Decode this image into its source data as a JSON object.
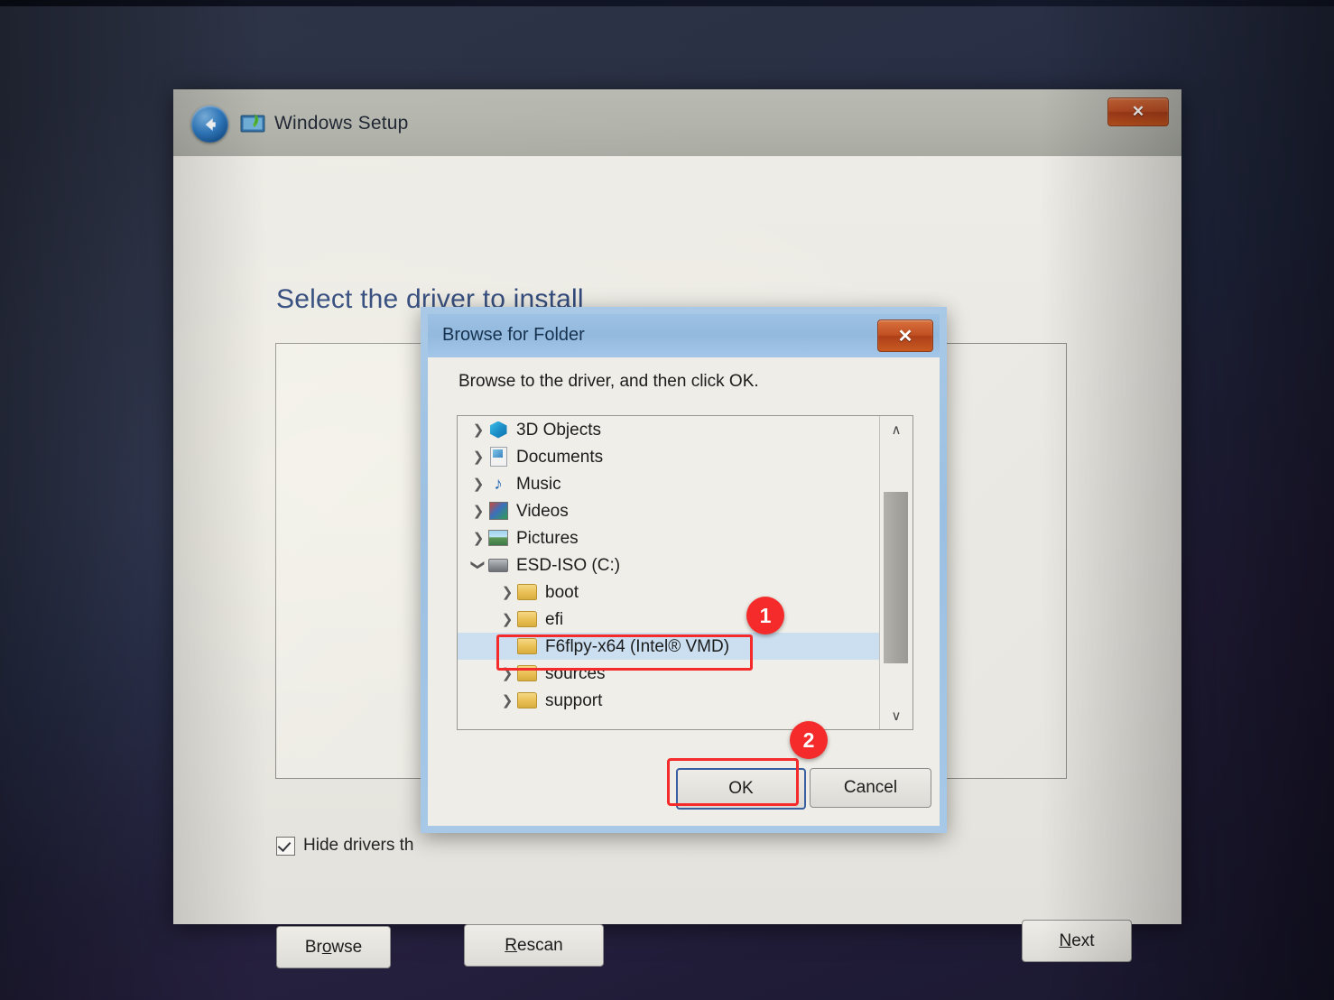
{
  "desktop": {
    "background_color": "#2b3145"
  },
  "setup_window": {
    "title": "Windows Setup",
    "back_icon": "back-arrow-icon",
    "app_icon": "windows-setup-icon",
    "close_label": "✕",
    "page_title": "Select the driver to install",
    "hide_drivers_label": "Hide drivers th",
    "hide_drivers_checked": true,
    "buttons": {
      "browse": {
        "before": "Br",
        "mnemonic": "o",
        "after": "wse"
      },
      "rescan": {
        "before": "",
        "mnemonic": "R",
        "after": "escan"
      },
      "next": {
        "before": "",
        "mnemonic": "N",
        "after": "ext"
      }
    }
  },
  "browse_dialog": {
    "title": "Browse for Folder",
    "close_label": "✕",
    "instruction": "Browse to the driver, and then click OK.",
    "tree": [
      {
        "label": "3D Objects",
        "icon": "cube-icon",
        "icon_class": "ic-3d",
        "chevron": "collapsed",
        "indent": false,
        "selected": false
      },
      {
        "label": "Documents",
        "icon": "document-icon",
        "icon_class": "ic-doc",
        "chevron": "collapsed",
        "indent": false,
        "selected": false
      },
      {
        "label": "Music",
        "icon": "music-icon",
        "icon_class": "ic-music",
        "chevron": "collapsed",
        "indent": false,
        "selected": false
      },
      {
        "label": "Videos",
        "icon": "video-icon",
        "icon_class": "ic-video",
        "chevron": "collapsed",
        "indent": false,
        "selected": false
      },
      {
        "label": "Pictures",
        "icon": "picture-icon",
        "icon_class": "ic-pic",
        "chevron": "collapsed",
        "indent": false,
        "selected": false
      },
      {
        "label": "ESD-ISO (C:)",
        "icon": "drive-icon",
        "icon_class": "ic-drive",
        "chevron": "expanded",
        "indent": false,
        "selected": false
      },
      {
        "label": "boot",
        "icon": "folder-icon",
        "icon_class": "ic-folder",
        "chevron": "collapsed",
        "indent": true,
        "selected": false
      },
      {
        "label": "efi",
        "icon": "folder-icon",
        "icon_class": "ic-folder",
        "chevron": "collapsed",
        "indent": true,
        "selected": false
      },
      {
        "label": "F6flpy-x64 (Intel® VMD)",
        "icon": "folder-icon",
        "icon_class": "ic-folder",
        "chevron": "none",
        "indent": true,
        "selected": true
      },
      {
        "label": "sources",
        "icon": "folder-icon",
        "icon_class": "ic-folder",
        "chevron": "collapsed",
        "indent": true,
        "selected": false
      },
      {
        "label": "support",
        "icon": "folder-icon",
        "icon_class": "ic-folder",
        "chevron": "collapsed",
        "indent": true,
        "selected": false
      }
    ],
    "scrollbar": {
      "up": "∧",
      "down": "∨"
    },
    "ok_label": "OK",
    "cancel_label": "Cancel"
  },
  "annotations": {
    "badge_1": "1",
    "badge_2": "2",
    "color": "#f52b2b"
  }
}
